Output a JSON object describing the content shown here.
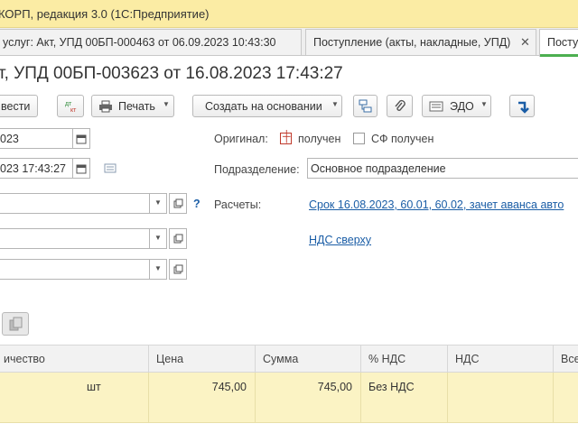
{
  "window": {
    "title": "КОРП, редакция 3.0  (1С:Предприятие)"
  },
  "tabs": [
    {
      "label": "услуг: Акт, УПД 00БП-000463 от 06.09.2023 10:43:30"
    },
    {
      "label": "Поступление (акты, накладные, УПД)"
    },
    {
      "label": "Поступ"
    }
  ],
  "document": {
    "title": "т, УПД 00БП-003623 от 16.08.2023 17:43:27"
  },
  "toolbar": {
    "post_label": "вести",
    "dtkt_top": "дт",
    "dtkt_bottom": "кт",
    "print_label": "Печать",
    "create_based_label": "Создать на основании",
    "edo_label": "ЭДО"
  },
  "form": {
    "date_value": "023",
    "datetime_value": "023 17:43:27",
    "original_label": "Оригинал:",
    "received_label": "получен",
    "sf_received_label": "СФ получен",
    "division_label": "Подразделение:",
    "division_value": "Основное подразделение",
    "settlements_label": "Расчеты:",
    "settlements_link": "Срок 16.08.2023, 60.01, 60.02, зачет аванса авто",
    "vat_link": "НДС сверху",
    "help_mark": "?"
  },
  "table": {
    "headers": [
      "ичество",
      "",
      "Цена",
      "Сумма",
      "% НДС",
      "НДС",
      "Все"
    ],
    "rows": [
      {
        "qty": "",
        "unit": "шт",
        "price": "745,00",
        "sum": "745,00",
        "vat_rate": "Без НДС",
        "vat": "",
        "total": ""
      }
    ]
  },
  "colors": {
    "titlebar": "#fbeca4",
    "active_tab_accent": "#4caf50",
    "link": "#1a5da6",
    "selected_row": "#fbf3c4"
  }
}
